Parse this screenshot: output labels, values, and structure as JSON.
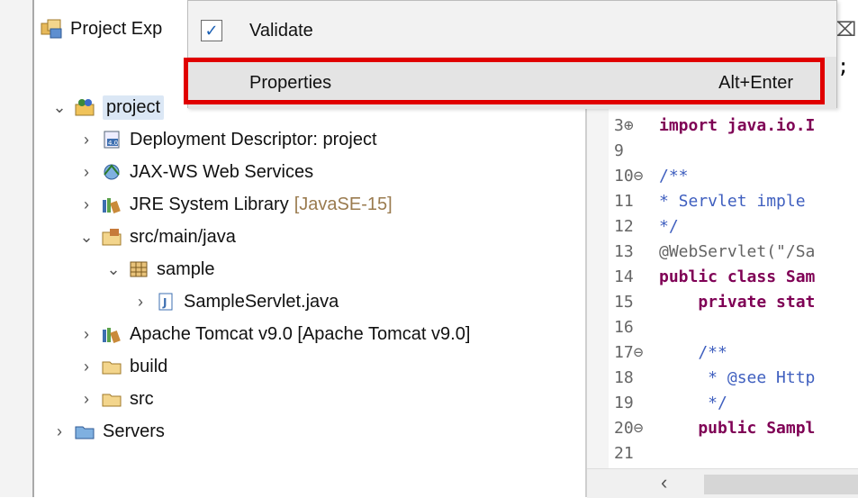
{
  "explorer": {
    "tab_label": "Project Exp",
    "tree": [
      {
        "label": "project",
        "expanded": true,
        "icon": "project-icon",
        "depth": 0,
        "selected": true
      },
      {
        "label": "Deployment Descriptor: project",
        "expanded": false,
        "icon": "deployment-descriptor-icon",
        "depth": 1
      },
      {
        "label": "JAX-WS Web Services",
        "expanded": false,
        "icon": "web-services-icon",
        "depth": 1
      },
      {
        "label": "JRE System Library",
        "decoration": "[JavaSE-15]",
        "expanded": false,
        "icon": "library-icon",
        "depth": 1
      },
      {
        "label": "src/main/java",
        "expanded": true,
        "icon": "source-folder-icon",
        "depth": 1
      },
      {
        "label": "sample",
        "expanded": true,
        "icon": "package-icon",
        "depth": 2
      },
      {
        "label": "SampleServlet.java",
        "expanded": false,
        "icon": "java-file-icon",
        "depth": 3
      },
      {
        "label": "Apache Tomcat v9.0 [Apache Tomcat v9.0]",
        "expanded": false,
        "icon": "library-icon",
        "depth": 1
      },
      {
        "label": "build",
        "expanded": false,
        "icon": "folder-icon",
        "depth": 1
      },
      {
        "label": "src",
        "expanded": false,
        "icon": "folder-icon",
        "depth": 1
      },
      {
        "label": "Servers",
        "expanded": false,
        "icon": "folder-icon",
        "depth": 0
      }
    ]
  },
  "menu": {
    "items": [
      {
        "label": "Validate",
        "checked": true,
        "shortcut": ""
      },
      {
        "label": "Properties",
        "checked": false,
        "shortcut": "Alt+Enter",
        "highlighted": true
      }
    ]
  },
  "editor": {
    "top_partial": ";",
    "lines": [
      {
        "num": "3⊕",
        "text": "import java.io.I"
      },
      {
        "num": "9",
        "text": ""
      },
      {
        "num": "10⊖",
        "text": "/**"
      },
      {
        "num": "11",
        "text": " * Servlet imple"
      },
      {
        "num": "12",
        "text": " */"
      },
      {
        "num": "13",
        "text": "@WebServlet(\"/Sa"
      },
      {
        "num": "14",
        "text": "public class Sam"
      },
      {
        "num": "15",
        "text": "    private stat"
      },
      {
        "num": "16",
        "text": ""
      },
      {
        "num": "17⊖",
        "text": "    /**"
      },
      {
        "num": "18",
        "text": "     * @see Http"
      },
      {
        "num": "19",
        "text": "     */"
      },
      {
        "num": "20⊖",
        "text": "    public Sampl"
      },
      {
        "num": "21",
        "text": ""
      }
    ]
  },
  "colors": {
    "highlight_border": "#e00000",
    "selected_bg": "#dbe7f5"
  }
}
